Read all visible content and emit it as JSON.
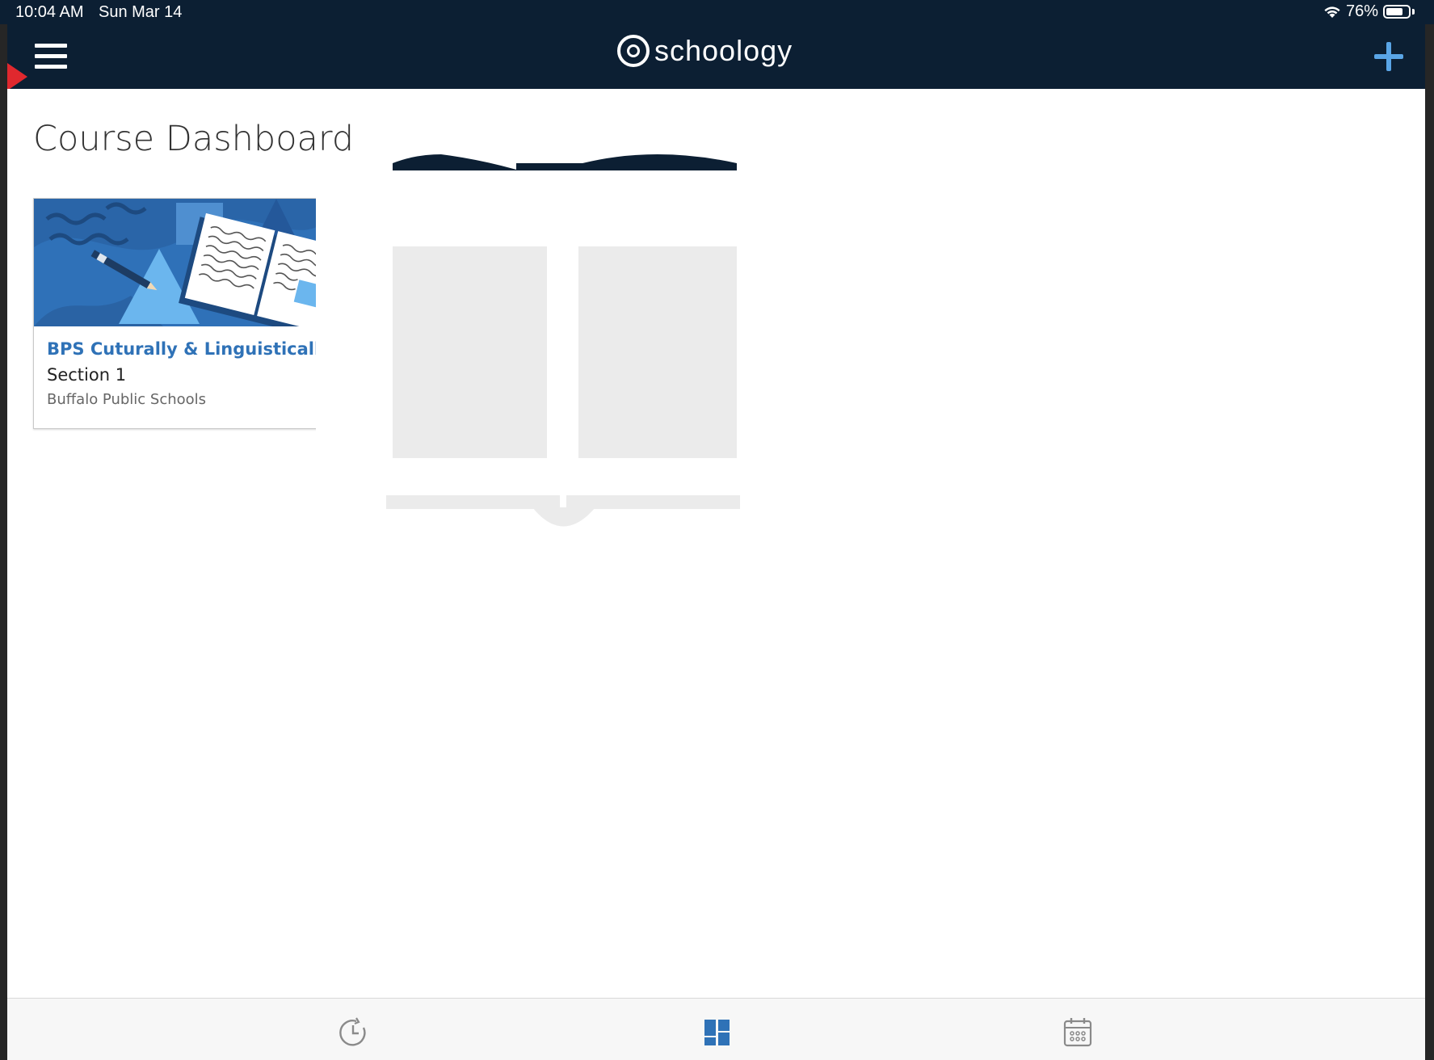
{
  "status_bar": {
    "time": "10:04 AM",
    "date": "Sun Mar 14",
    "battery_text": "76%",
    "battery_level": 0.76,
    "wifi_icon": "wifi-icon"
  },
  "header": {
    "logo_text": "schoology",
    "menu_icon": "hamburger-menu-icon",
    "add_icon": "plus-icon",
    "accent_color": "#5aa5e6",
    "background_color": "#0c1f33"
  },
  "page": {
    "title": "Course Dashboard"
  },
  "courses": [
    {
      "title": "BPS Cuturally & Linguistically Responsive Teaching",
      "section": "Section 1",
      "school": "Buffalo Public Schools",
      "title_color": "#2f72b7"
    }
  ],
  "loading": {
    "icon": "open-book-icon"
  },
  "tab_bar": {
    "items": [
      {
        "name": "recent-activity",
        "icon": "clock-icon",
        "active": false
      },
      {
        "name": "course-dashboard",
        "icon": "dashboard-grid-icon",
        "active": true
      },
      {
        "name": "calendar",
        "icon": "calendar-icon",
        "active": false
      }
    ],
    "active_color": "#2f72b7"
  }
}
